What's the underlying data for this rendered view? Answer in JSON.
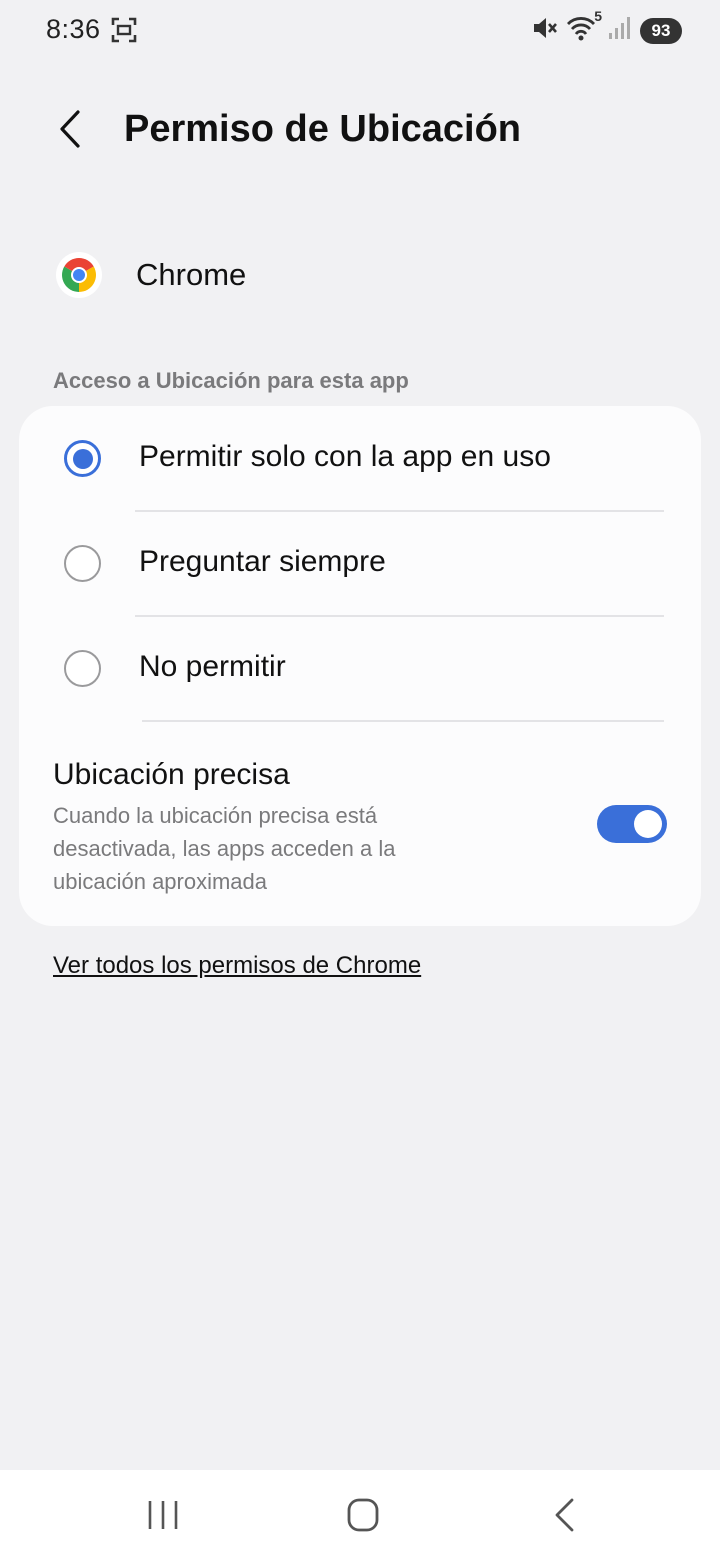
{
  "status_bar": {
    "time": "8:36",
    "wifi_label": "5",
    "battery": "93",
    "icons": [
      "screenshot-icon",
      "mute-icon",
      "wifi-icon",
      "signal-icon",
      "battery-icon"
    ]
  },
  "header": {
    "title": "Permiso de Ubicación",
    "back_icon": "chevron-left-icon"
  },
  "app": {
    "name": "Chrome",
    "icon": "chrome-icon"
  },
  "section": {
    "label": "Acceso a Ubicación para esta app"
  },
  "options": [
    {
      "label": "Permitir solo con la app en uso",
      "selected": true
    },
    {
      "label": "Preguntar siempre",
      "selected": false
    },
    {
      "label": "No permitir",
      "selected": false
    }
  ],
  "precise_location": {
    "title": "Ubicación precisa",
    "description": "Cuando la ubicación precisa está desactivada, las apps acceden a la ubicación aproximada",
    "enabled": true
  },
  "link": {
    "label": "Ver todos los permisos de Chrome"
  },
  "nav_bar": {
    "icons": [
      "recents-icon",
      "home-icon",
      "back-icon"
    ]
  },
  "colors": {
    "accent": "#3a6fd9",
    "background": "#f1f1f3",
    "card": "#fcfcfd"
  }
}
